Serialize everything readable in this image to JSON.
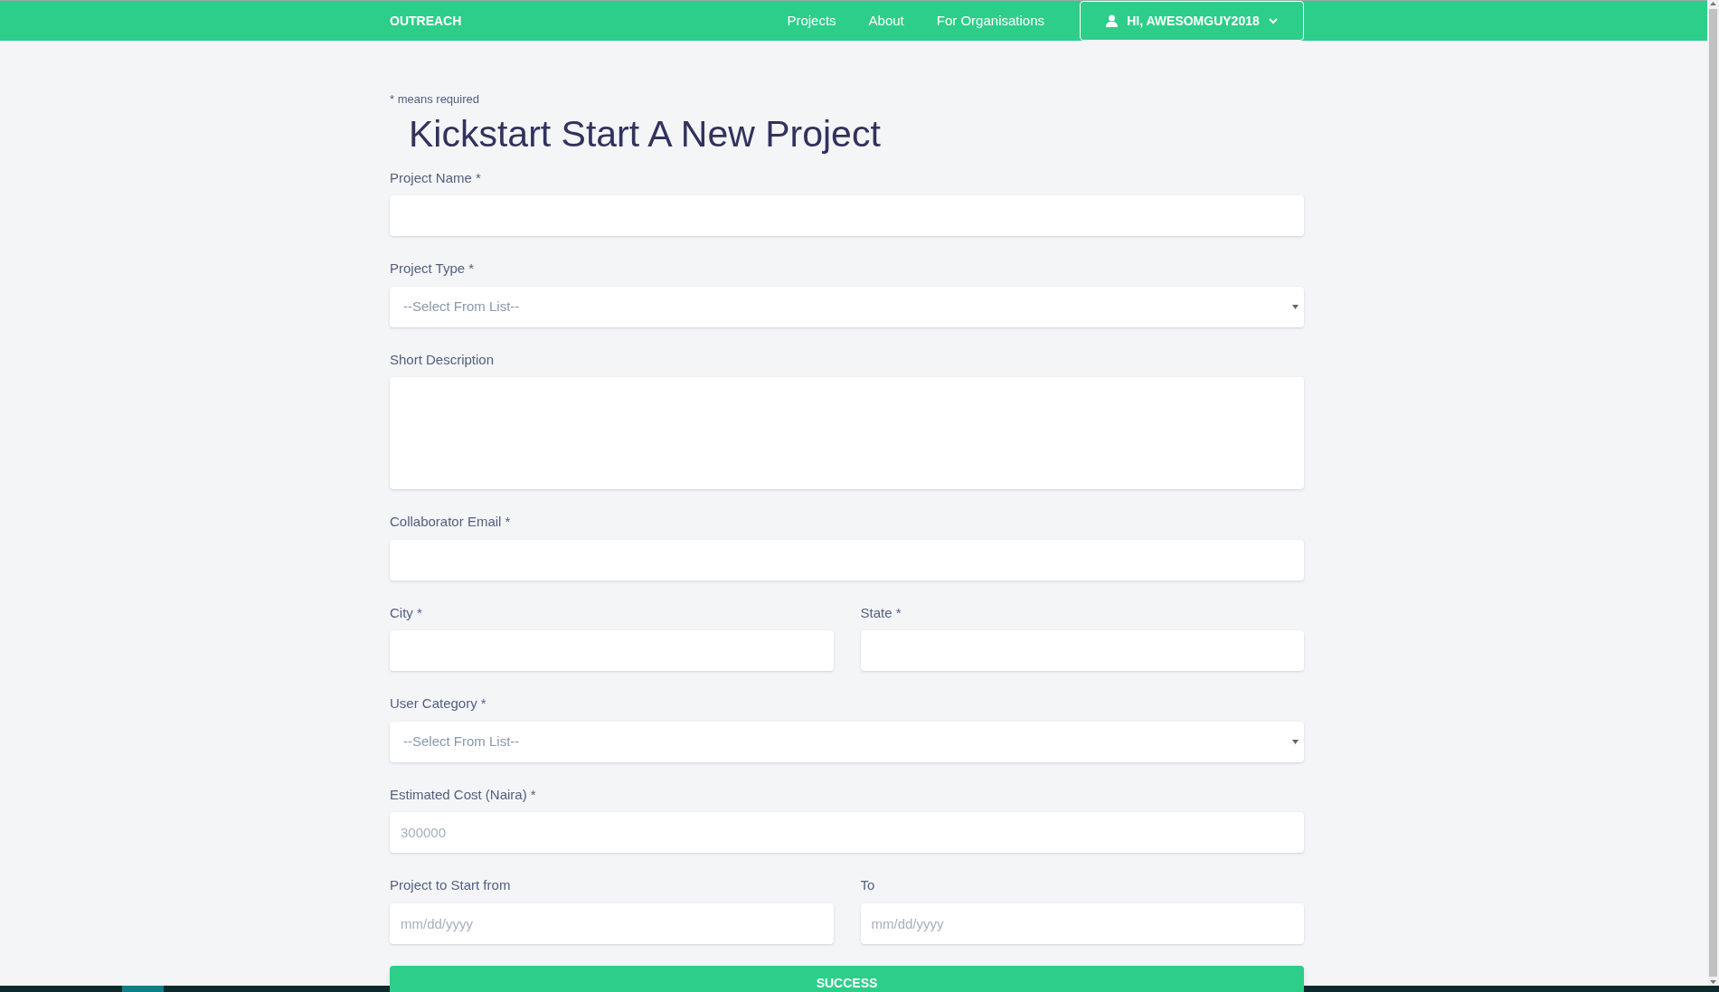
{
  "navbar": {
    "brand": "OUTREACH",
    "links": [
      {
        "label": "Projects"
      },
      {
        "label": "About"
      },
      {
        "label": "For Organisations"
      }
    ],
    "user_menu": {
      "label": "HI, AWESOMGUY2018"
    }
  },
  "form": {
    "note": "* means required",
    "title": "Kickstart Start A New Project",
    "rows": [
      [
        {
          "kind": "input",
          "label": "Project Name *"
        }
      ],
      [
        {
          "kind": "select",
          "label": "Project Type *",
          "value": "--Select From List--"
        }
      ],
      [
        {
          "kind": "textarea",
          "label": "Short Description"
        }
      ],
      [
        {
          "kind": "input",
          "label": "Collaborator Email *"
        }
      ],
      [
        {
          "kind": "input",
          "label": "City *"
        },
        {
          "kind": "input",
          "label": "State *"
        }
      ],
      [
        {
          "kind": "select",
          "label": "User Category *",
          "value": "--Select From List--"
        }
      ],
      [
        {
          "kind": "input",
          "label": "Estimated Cost (Naira) *",
          "placeholder": "300000"
        }
      ],
      [
        {
          "kind": "input",
          "label": "Project to Start from",
          "placeholder": "mm/dd/yyyy"
        },
        {
          "kind": "input",
          "label": "To",
          "placeholder": "mm/dd/yyyy"
        }
      ]
    ],
    "submit": {
      "label": "SUCCESS"
    }
  }
}
